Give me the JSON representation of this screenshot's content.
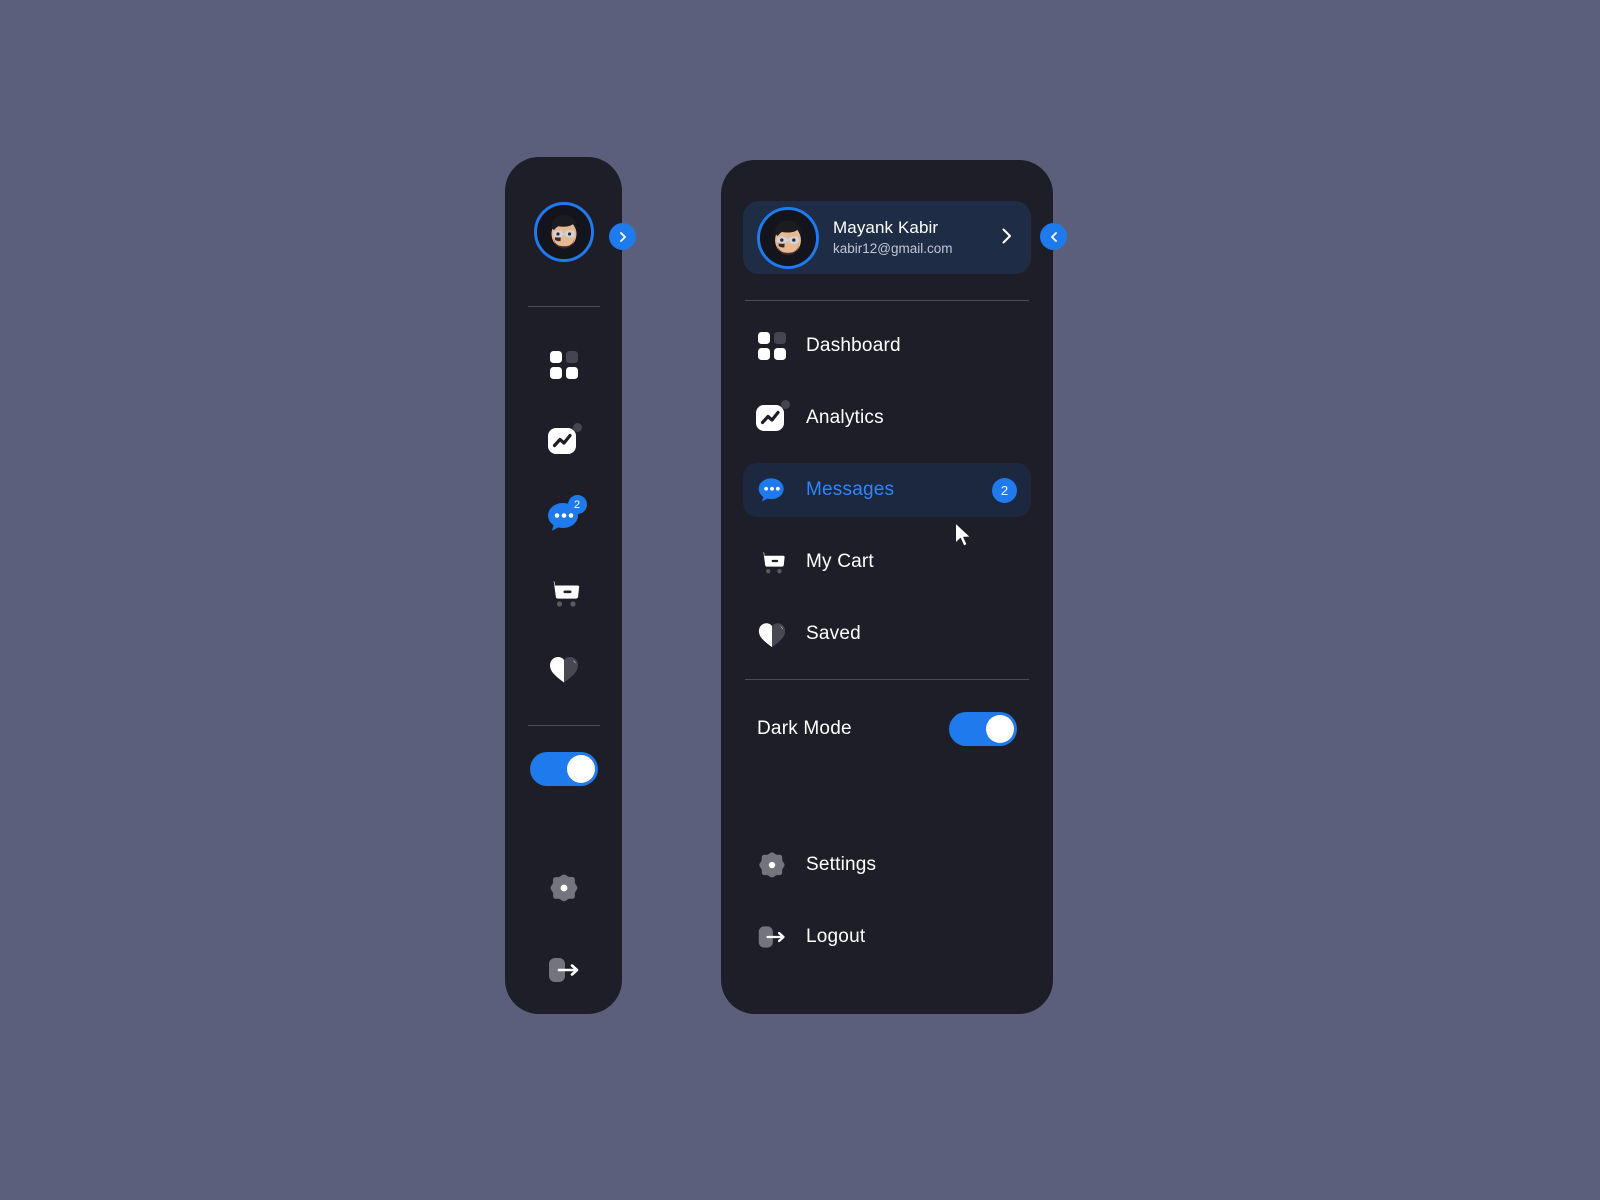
{
  "theme": {
    "page_background": "#5b5f7b",
    "panel_background": "#1e1e28",
    "accent_blue": "#1f7aed",
    "active_row_background": "#1c2740",
    "profile_card_background": "#1e2c46",
    "text_primary": "#ffffff",
    "text_secondary": "#c3c6d2",
    "icon_muted": "#77777f",
    "divider": "#4a4a58"
  },
  "profile": {
    "name": "Mayank Kabir",
    "email": "kabir12@gmail.com",
    "avatar_icon": "memoji-avatar",
    "chevron_icon": "chevron-right-icon"
  },
  "rail": {
    "expand_button": {
      "icon": "chevron-right-icon",
      "label": "›"
    },
    "avatar_icon": "memoji-avatar",
    "items": [
      {
        "name": "dashboard",
        "icon": "grid-icon"
      },
      {
        "name": "analytics",
        "icon": "analytics-chart-icon"
      },
      {
        "name": "messages",
        "icon": "chat-bubble-icon",
        "badge": "2"
      },
      {
        "name": "my-cart",
        "icon": "shopping-cart-icon"
      },
      {
        "name": "saved",
        "icon": "heart-icon"
      }
    ],
    "dark_mode_toggle": {
      "state": "on"
    },
    "bottom_items": [
      {
        "name": "settings",
        "icon": "gear-icon"
      },
      {
        "name": "logout",
        "icon": "logout-icon"
      }
    ]
  },
  "panel": {
    "collapse_button": {
      "icon": "chevron-left-icon",
      "label": "‹"
    },
    "menu": [
      {
        "label": "Dashboard",
        "icon": "grid-icon",
        "active": false,
        "badge": ""
      },
      {
        "label": "Analytics",
        "icon": "analytics-chart-icon",
        "active": false,
        "badge": ""
      },
      {
        "label": "Messages",
        "icon": "chat-bubble-icon",
        "active": true,
        "badge": "2"
      },
      {
        "label": "My Cart",
        "icon": "shopping-cart-icon",
        "active": false,
        "badge": ""
      },
      {
        "label": "Saved",
        "icon": "heart-icon",
        "active": false,
        "badge": ""
      }
    ],
    "dark_mode": {
      "label": "Dark Mode",
      "state": "on"
    },
    "bottom": [
      {
        "label": "Settings",
        "icon": "gear-icon"
      },
      {
        "label": "Logout",
        "icon": "logout-icon"
      }
    ]
  }
}
